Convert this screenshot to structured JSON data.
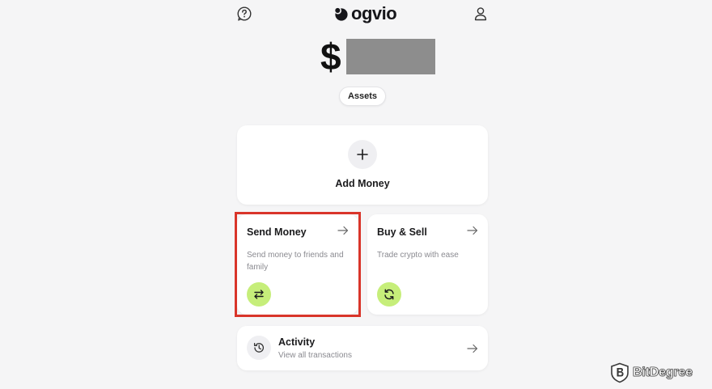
{
  "header": {
    "logo_text": "ogvio",
    "help_icon": "help-circle-icon",
    "profile_icon": "user-icon"
  },
  "balance": {
    "currency_symbol": "$",
    "amount_masked": true
  },
  "assets_button": {
    "label": "Assets"
  },
  "add_money": {
    "label": "Add Money",
    "icon": "plus-icon"
  },
  "tiles": [
    {
      "title": "Send Money",
      "description": "Send money to friends and family",
      "icon": "transfer-arrows-icon",
      "arrow_icon": "arrow-right-icon"
    },
    {
      "title": "Buy & Sell",
      "description": "Trade crypto with ease",
      "icon": "refresh-icon",
      "arrow_icon": "arrow-right-icon"
    }
  ],
  "activity": {
    "title": "Activity",
    "subtitle": "View all transactions",
    "icon": "history-icon"
  },
  "watermark": {
    "text": "BitDegree"
  },
  "colors": {
    "background": "#f5f5f6",
    "accent_green": "#c6ee7a",
    "highlight_red": "#d9352a",
    "muted_text": "#8a8a90"
  }
}
